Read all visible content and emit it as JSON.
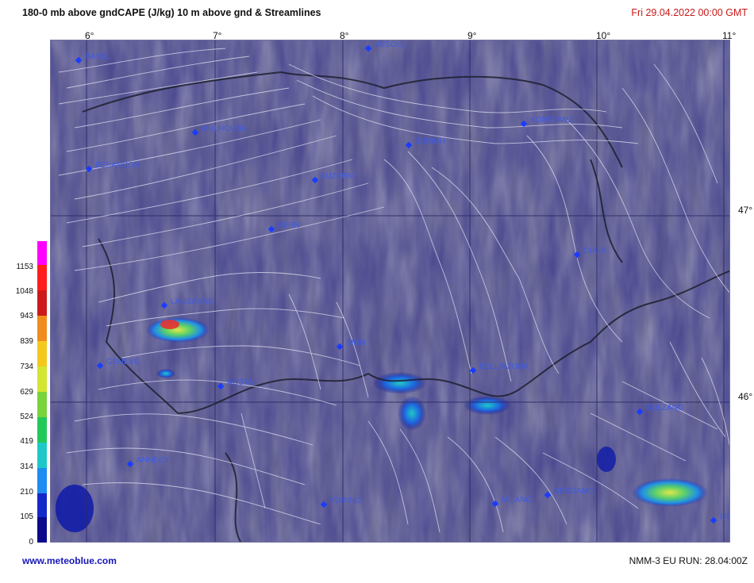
{
  "header": {
    "title": "180-0 mb above gndCAPE (J/kg) 10 m above gnd & Streamlines",
    "datetime": "Fri 29.04.2022  00:00 GMT"
  },
  "axes": {
    "longitudes": [
      "6°",
      "7°",
      "8°",
      "9°",
      "10°",
      "11°"
    ],
    "latitudes": [
      "47°",
      "46°"
    ]
  },
  "colorbar": {
    "labels": [
      "1153",
      "1048",
      "943",
      "839",
      "734",
      "629",
      "524",
      "419",
      "314",
      "210",
      "105",
      "0"
    ],
    "colors": [
      "#ff00ff",
      "#ff1d1d",
      "#cc1a1a",
      "#f08c1e",
      "#f5c81e",
      "#d2e632",
      "#7ad23c",
      "#23c85a",
      "#1ec8c8",
      "#1e8cf0",
      "#1428c8",
      "#0a0a8a"
    ]
  },
  "cities": [
    {
      "name": "BASEL"
    },
    {
      "name": "VESOUL"
    },
    {
      "name": "MULHOUSE"
    },
    {
      "name": "ZURICH"
    },
    {
      "name": "BESANCON"
    },
    {
      "name": "LUZERN"
    },
    {
      "name": "BERN"
    },
    {
      "name": "LAUSANNE"
    },
    {
      "name": "GENEVE"
    },
    {
      "name": "SION"
    },
    {
      "name": "AOSTA"
    },
    {
      "name": "ANNECY"
    },
    {
      "name": "BELLINZONA"
    },
    {
      "name": "BERGAMO"
    },
    {
      "name": "MILANO"
    },
    {
      "name": "TORINO"
    },
    {
      "name": "BOLZANO"
    },
    {
      "name": "CHUR"
    },
    {
      "name": "KONSTANZ"
    },
    {
      "name": "LIENZ"
    }
  ],
  "footer": {
    "site": "www.meteoblue.com",
    "run": "NMM-3 EU  RUN: 28.04:00Z"
  }
}
